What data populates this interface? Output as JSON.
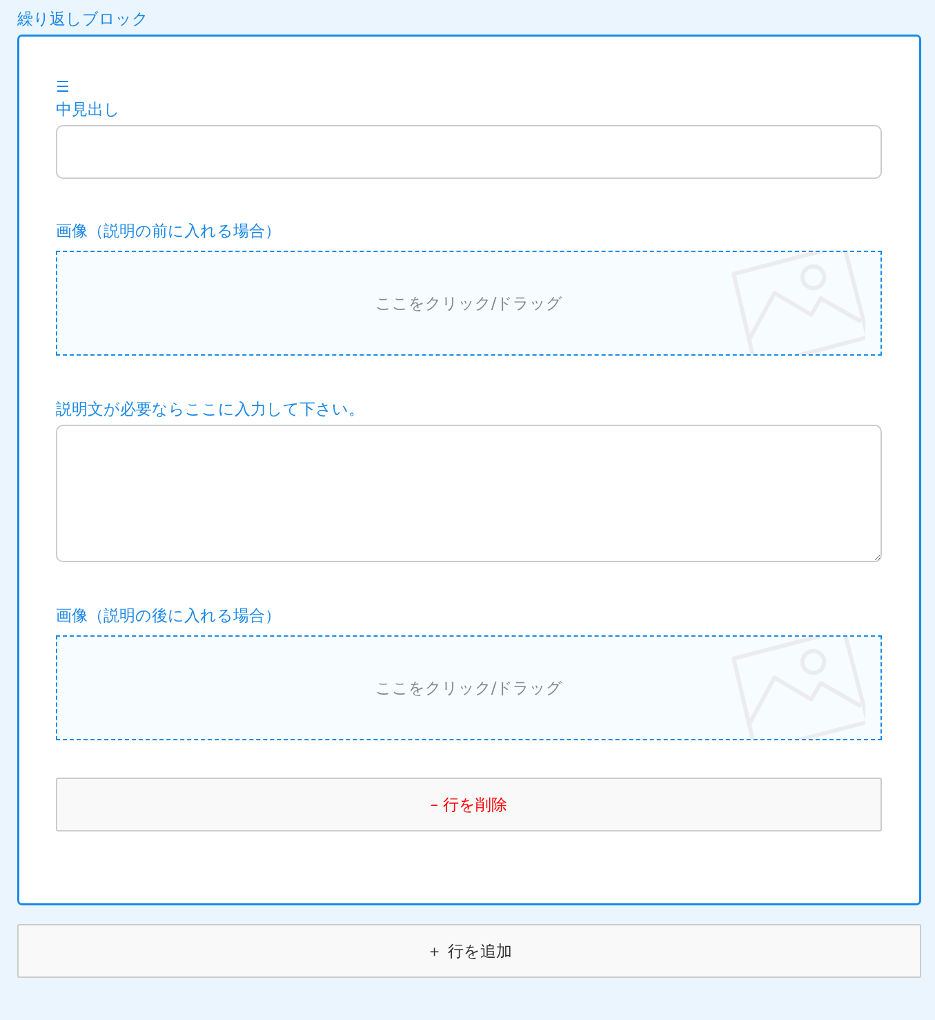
{
  "block_title": "繰り返しブロック",
  "row": {
    "handle": "☰",
    "fields": [
      {
        "kind": "text",
        "label": "中見出し"
      },
      {
        "kind": "image",
        "label": "画像（説明の前に入れる場合）",
        "hint": "ここをクリック/ドラッグ"
      },
      {
        "kind": "textarea",
        "label": "説明文が必要ならここに入力して下さい。"
      },
      {
        "kind": "image",
        "label": "画像（説明の後に入れる場合）",
        "hint": "ここをクリック/ドラッグ"
      }
    ],
    "delete_button": "– 行を削除"
  },
  "add_button": "＋ 行を追加"
}
